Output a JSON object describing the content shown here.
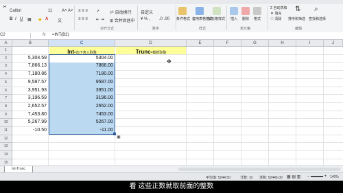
{
  "ribbon": {
    "font_name": "Calibri",
    "font_size": "11",
    "wrap_text": "自动换行",
    "number_format": "自定义",
    "merge_center": "合并后居中",
    "group_alignment": "对齐方式",
    "group_number": "数字",
    "group_styles": "样式",
    "group_cells": "单元格",
    "group_editing": "编辑",
    "cond_format": "条件格式",
    "table_format": "套用表格格式",
    "cell_styles": "单元格样式",
    "insert": "插入",
    "delete": "删除",
    "format": "格式",
    "autosum": "自动求和",
    "fill": "填充",
    "clear": "清除",
    "sort_filter": "排序和筛选",
    "find_select": "查找和选择"
  },
  "formula_bar": {
    "name_box": "C2",
    "fx": "fx",
    "formula": "=INT(B2)"
  },
  "columns": [
    "A",
    "B",
    "C",
    "D",
    "E",
    "F",
    "G",
    "H",
    "I",
    "J"
  ],
  "rows": [
    "1",
    "2",
    "3",
    "4",
    "5",
    "6",
    "7",
    "8",
    "9",
    "10",
    "11",
    "12",
    "13",
    "14",
    "15",
    "16"
  ],
  "headers": {
    "c_main": "Int-",
    "c_sub": "向下舍入取整",
    "d_main": "Trunc-",
    "d_sub": "截断取整"
  },
  "values_b": [
    "5,304.59",
    "7,866.13",
    "7,180.86",
    "9,587.57",
    "3,951.93",
    "3,196.59",
    "2,652.57",
    "7,453.80",
    "5,267.99",
    "-10.50"
  ],
  "values_c": [
    "5304.00",
    "7866.00",
    "7180.00",
    "9587.00",
    "3951.00",
    "3196.00",
    "2652.00",
    "7453.00",
    "5267.00",
    "-11.00"
  ],
  "sheet_tab": "Int-Trunc",
  "status": {
    "average": "平均值: 5244.50",
    "count": "计数: 10",
    "sum": "求和: 52445.00",
    "zoom": "140%"
  },
  "subtitle": "看  这些正数就取前面的整数"
}
